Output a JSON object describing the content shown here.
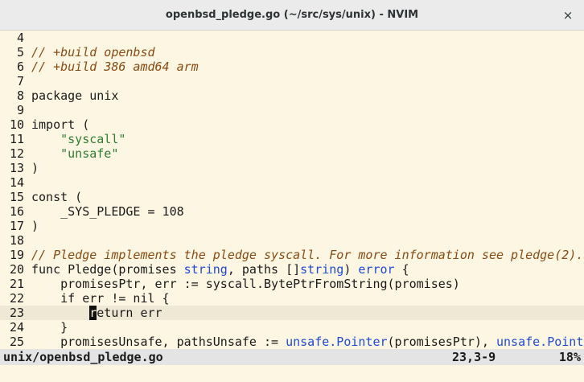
{
  "window": {
    "title": "openbsd_pledge.go (~/src/sys/unix) - NVIM",
    "close_glyph": "×"
  },
  "editor": {
    "lines": [
      {
        "num": "4",
        "tokens": []
      },
      {
        "num": "5",
        "tokens": [
          {
            "c": "comment",
            "t": "// +build openbsd"
          }
        ]
      },
      {
        "num": "6",
        "tokens": [
          {
            "c": "comment",
            "t": "// +build 386 amd64 arm"
          }
        ]
      },
      {
        "num": "7",
        "tokens": []
      },
      {
        "num": "8",
        "tokens": [
          {
            "c": "",
            "t": "package unix"
          }
        ]
      },
      {
        "num": "9",
        "tokens": []
      },
      {
        "num": "10",
        "tokens": [
          {
            "c": "",
            "t": "import ("
          }
        ]
      },
      {
        "num": "11",
        "tokens": [
          {
            "c": "",
            "t": "    "
          },
          {
            "c": "str",
            "t": "\"syscall\""
          }
        ]
      },
      {
        "num": "12",
        "tokens": [
          {
            "c": "",
            "t": "    "
          },
          {
            "c": "str",
            "t": "\"unsafe\""
          }
        ]
      },
      {
        "num": "13",
        "tokens": [
          {
            "c": "",
            "t": ")"
          }
        ]
      },
      {
        "num": "14",
        "tokens": []
      },
      {
        "num": "15",
        "tokens": [
          {
            "c": "",
            "t": "const ("
          }
        ]
      },
      {
        "num": "16",
        "tokens": [
          {
            "c": "",
            "t": "    _SYS_PLEDGE = 108"
          }
        ]
      },
      {
        "num": "17",
        "tokens": [
          {
            "c": "",
            "t": ")"
          }
        ]
      },
      {
        "num": "18",
        "tokens": []
      },
      {
        "num": "19",
        "tokens": [
          {
            "c": "comment",
            "t": "// Pledge implements the pledge syscall. For more information see pledge(2)."
          }
        ]
      },
      {
        "num": "20",
        "tokens": [
          {
            "c": "",
            "t": "func Pledge(promises "
          },
          {
            "c": "type",
            "t": "string"
          },
          {
            "c": "",
            "t": ", paths []"
          },
          {
            "c": "type",
            "t": "string"
          },
          {
            "c": "",
            "t": ") "
          },
          {
            "c": "type",
            "t": "error"
          },
          {
            "c": "",
            "t": " {"
          }
        ]
      },
      {
        "num": "21",
        "tokens": [
          {
            "c": "",
            "t": "    promisesPtr, err := syscall.BytePtrFromString(promises)"
          }
        ]
      },
      {
        "num": "22",
        "tokens": [
          {
            "c": "",
            "t": "    if err != nil {"
          }
        ]
      },
      {
        "num": "23",
        "cursorline": true,
        "tokens": [
          {
            "c": "",
            "t": "        "
          },
          {
            "c": "cursor",
            "t": "r"
          },
          {
            "c": "",
            "t": "eturn err"
          }
        ]
      },
      {
        "num": "24",
        "tokens": [
          {
            "c": "",
            "t": "    }"
          }
        ]
      },
      {
        "num": "25",
        "tokens": [
          {
            "c": "",
            "t": "    promisesUnsafe, pathsUnsafe := "
          },
          {
            "c": "type",
            "t": "unsafe.Pointer"
          },
          {
            "c": "",
            "t": "(promisesPtr), "
          },
          {
            "c": "type",
            "t": "unsafe.Pointer"
          }
        ]
      }
    ]
  },
  "statusline": {
    "file": "unix/openbsd_pledge.go",
    "position": "23,3-9",
    "percent": "18%"
  },
  "colors": {
    "background": "#fdf6e3",
    "comment": "#8a4b12",
    "string": "#2e7d32",
    "type": "#1d4bd6",
    "cursorline": "#eee8d5"
  }
}
